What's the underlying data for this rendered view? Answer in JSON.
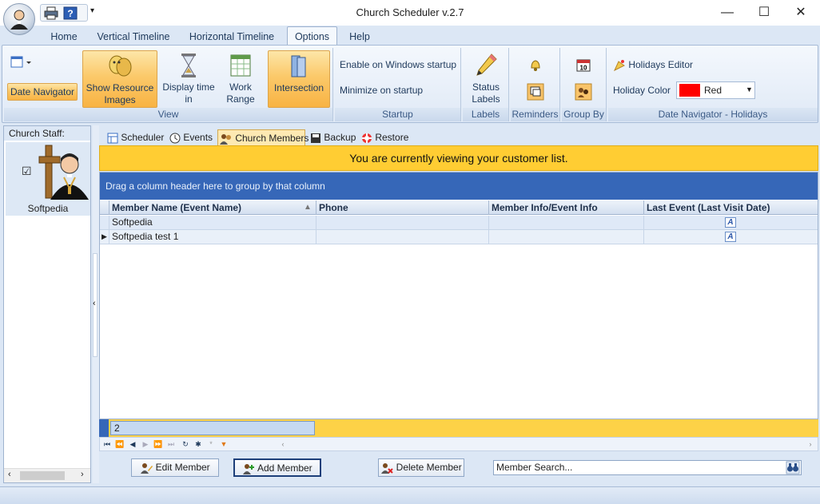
{
  "window": {
    "title": "Church Scheduler v.2.7",
    "minimize": "—",
    "maximize": "☐",
    "close": "✕"
  },
  "qat": {
    "customize": "▾"
  },
  "tabs": [
    "Home",
    "Vertical Timeline",
    "Horizontal Timeline",
    "Options",
    "Help"
  ],
  "ribbon": {
    "view": {
      "date_navigator": "Date Navigator",
      "show_resource_images": "Show Resource Images",
      "display_time_in": "Display time in",
      "work_range": "Work Range",
      "intersection": "Intersection",
      "label": "View"
    },
    "startup": {
      "enable_windows_startup": "Enable on Windows startup",
      "minimize_on_startup": "Minimize on startup",
      "label": "Startup"
    },
    "labels": {
      "status_labels": "Status Labels",
      "label": "Labels"
    },
    "reminders": {
      "label": "Reminders"
    },
    "group_by": {
      "label": "Group By"
    },
    "holidays": {
      "holidays_editor": "Holidays Editor",
      "holiday_color_label": "Holiday Color",
      "holiday_color_value": "Red",
      "holiday_color_hex": "#ff0000",
      "label": "Date Navigator - Holidays"
    }
  },
  "sidebar": {
    "header": "Church Staff:",
    "staff": [
      {
        "name": "Softpedia",
        "checked": "☑"
      }
    ]
  },
  "doc_tabs": [
    "Scheduler",
    "Events",
    "Church Members",
    "Backup",
    "Restore"
  ],
  "banner": "You are currently viewing your customer list.",
  "grid": {
    "group_hint": "Drag a column header here to group by that column",
    "columns": [
      "Member Name (Event Name)",
      "Phone",
      "Member Info/Event Info",
      "Last Event (Last Visit Date)"
    ],
    "rows": [
      {
        "name": "Softpedia",
        "phone": "",
        "info": "",
        "last": "A"
      },
      {
        "name": "Softpedia test 1",
        "phone": "",
        "info": "",
        "last": "A"
      }
    ],
    "count": "2"
  },
  "actions": {
    "edit": "Edit Member",
    "add": "Add Member",
    "delete": "Delete Member"
  },
  "search": {
    "placeholder": "Member Search..."
  },
  "colors": {
    "accent_blue": "#3667b8",
    "banner_yellow": "#ffcd33",
    "active_orange": "#fbc96a"
  }
}
